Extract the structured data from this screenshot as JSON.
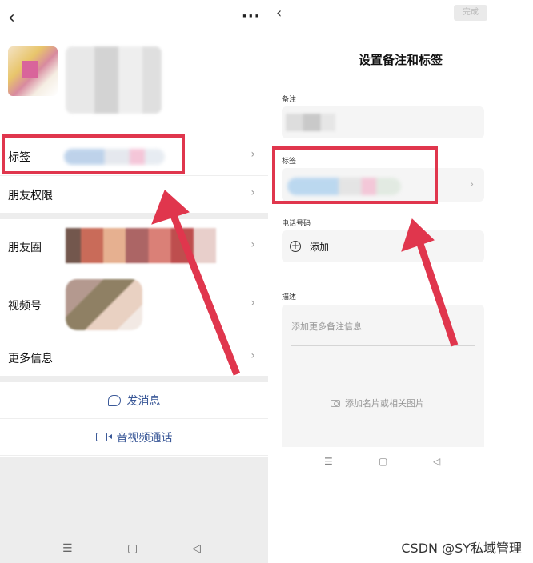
{
  "left_panel": {
    "back_icon": "‹",
    "more_icon": "···",
    "rows": {
      "tags_label": "标签",
      "permissions_label": "朋友权限",
      "moments_label": "朋友圈",
      "channels_label": "视频号",
      "more_info_label": "更多信息"
    },
    "chevron": "›",
    "actions": {
      "send_message_label": "发消息",
      "av_call_label": "音视频通话"
    },
    "nav": {
      "menu": "☰",
      "home": "▢",
      "back": "◁"
    }
  },
  "right_panel": {
    "back_icon": "‹",
    "done_label": "完成",
    "title": "设置备注和标签",
    "remark_label": "备注",
    "tags_label": "标签",
    "phone_label": "电话号码",
    "add_icon": "+",
    "add_label": "添加",
    "description_label": "描述",
    "description_placeholder": "添加更多备注信息",
    "photo_placeholder": "添加名片或相关图片",
    "chevron": "›",
    "nav": {
      "menu": "☰",
      "home": "▢",
      "back": "◁"
    }
  },
  "annotation": {
    "highlight_color": "#e0364d"
  },
  "watermark": "CSDN @SY私域管理"
}
